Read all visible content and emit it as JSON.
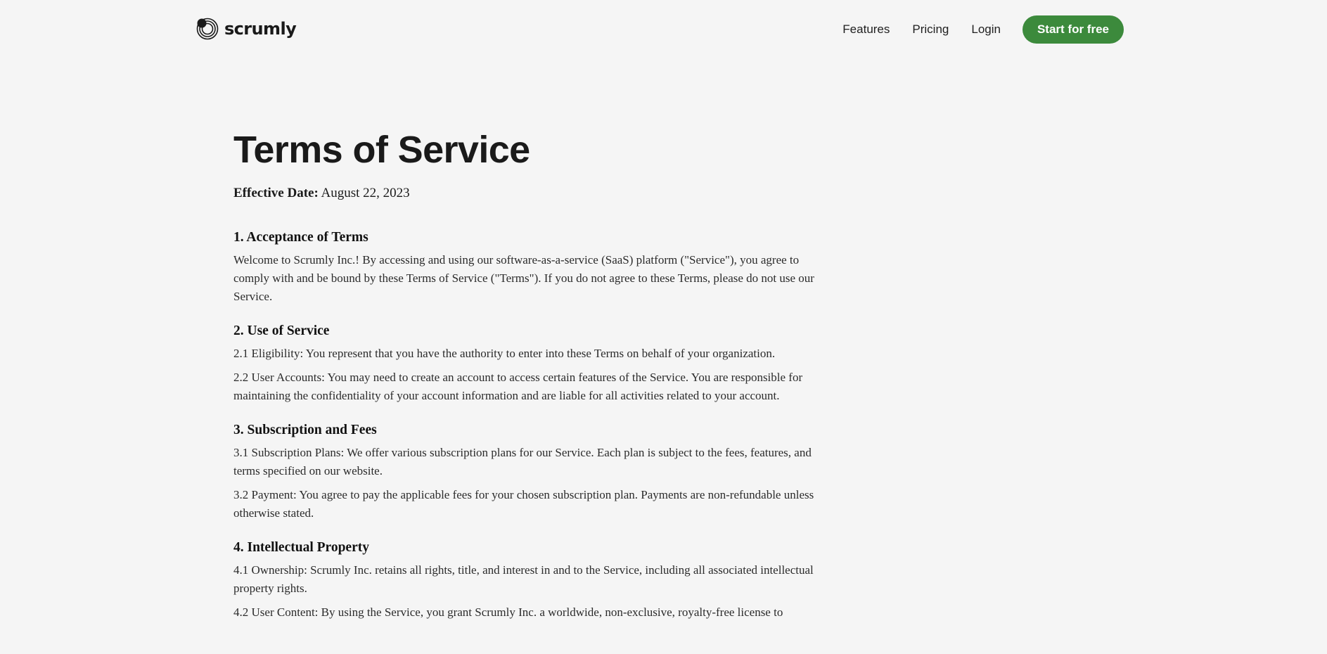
{
  "header": {
    "brand_name": "scrumly",
    "nav": {
      "features": "Features",
      "pricing": "Pricing",
      "login": "Login",
      "cta": "Start for free"
    }
  },
  "doc": {
    "title": "Terms of Service",
    "effective_label": "Effective Date:",
    "effective_value": " August 22, 2023",
    "sections": [
      {
        "heading": "1. Acceptance of Terms",
        "paragraphs": [
          "Welcome to Scrumly Inc.! By accessing and using our software-as-a-service (SaaS) platform (\"Service\"), you agree to comply with and be bound by these Terms of Service (\"Terms\"). If you do not agree to these Terms, please do not use our Service."
        ]
      },
      {
        "heading": "2. Use of Service",
        "paragraphs": [
          "2.1 Eligibility: You represent that you have the authority to enter into these Terms on behalf of your organization.",
          "2.2 User Accounts: You may need to create an account to access certain features of the Service. You are responsible for maintaining the confidentiality of your account information and are liable for all activities related to your account."
        ]
      },
      {
        "heading": "3. Subscription and Fees",
        "paragraphs": [
          "3.1 Subscription Plans: We offer various subscription plans for our Service. Each plan is subject to the fees, features, and terms specified on our website.",
          "3.2 Payment: You agree to pay the applicable fees for your chosen subscription plan. Payments are non-refundable unless otherwise stated."
        ]
      },
      {
        "heading": "4. Intellectual Property",
        "paragraphs": [
          "4.1 Ownership: Scrumly Inc. retains all rights, title, and interest in and to the Service, including all associated intellectual property rights.",
          "4.2 User Content: By using the Service, you grant Scrumly Inc. a worldwide, non-exclusive, royalty-free license to"
        ]
      }
    ]
  },
  "colors": {
    "background": "#f5f5f5",
    "accent": "#3c8a3c",
    "text": "#1a1a1a"
  },
  "icons": {
    "brand": "scrumly-logo-icon"
  }
}
